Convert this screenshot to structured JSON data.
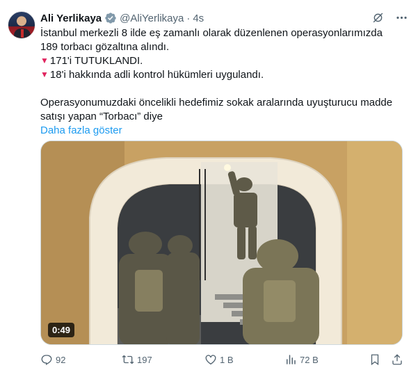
{
  "author": {
    "name": "Ali Yerlikaya",
    "handle": "@AliYerlikaya",
    "separator": "·",
    "time": "4s"
  },
  "tweet": {
    "line1": "İstanbul merkezli 8 ilde eş zamanlı olarak düzenlenen operasyonlarımızda 189 torbacı gözaltına alındı.",
    "line2": "171'i TUTUKLANDI.",
    "line3": "18'i hakkında adli kontrol hükümleri uygulandı.",
    "line4": "Operasyonumuzdaki öncelikli hedefimiz sokak aralarında uyuşturucu madde satışı yapan “Torbacı” diye",
    "show_more": "Daha fazla göster"
  },
  "media": {
    "duration": "0:49"
  },
  "actions": {
    "replies": "92",
    "reposts": "197",
    "likes": "1 B",
    "views": "72 B"
  },
  "colors": {
    "accent": "#1d9bf0",
    "muted": "#536471",
    "text": "#0f1419",
    "bullet": "#e0245e"
  },
  "icons": [
    "verified-badge-icon",
    "grok-icon",
    "more-icon",
    "reply-icon",
    "repost-icon",
    "like-icon",
    "views-icon",
    "bookmark-icon",
    "share-icon"
  ]
}
